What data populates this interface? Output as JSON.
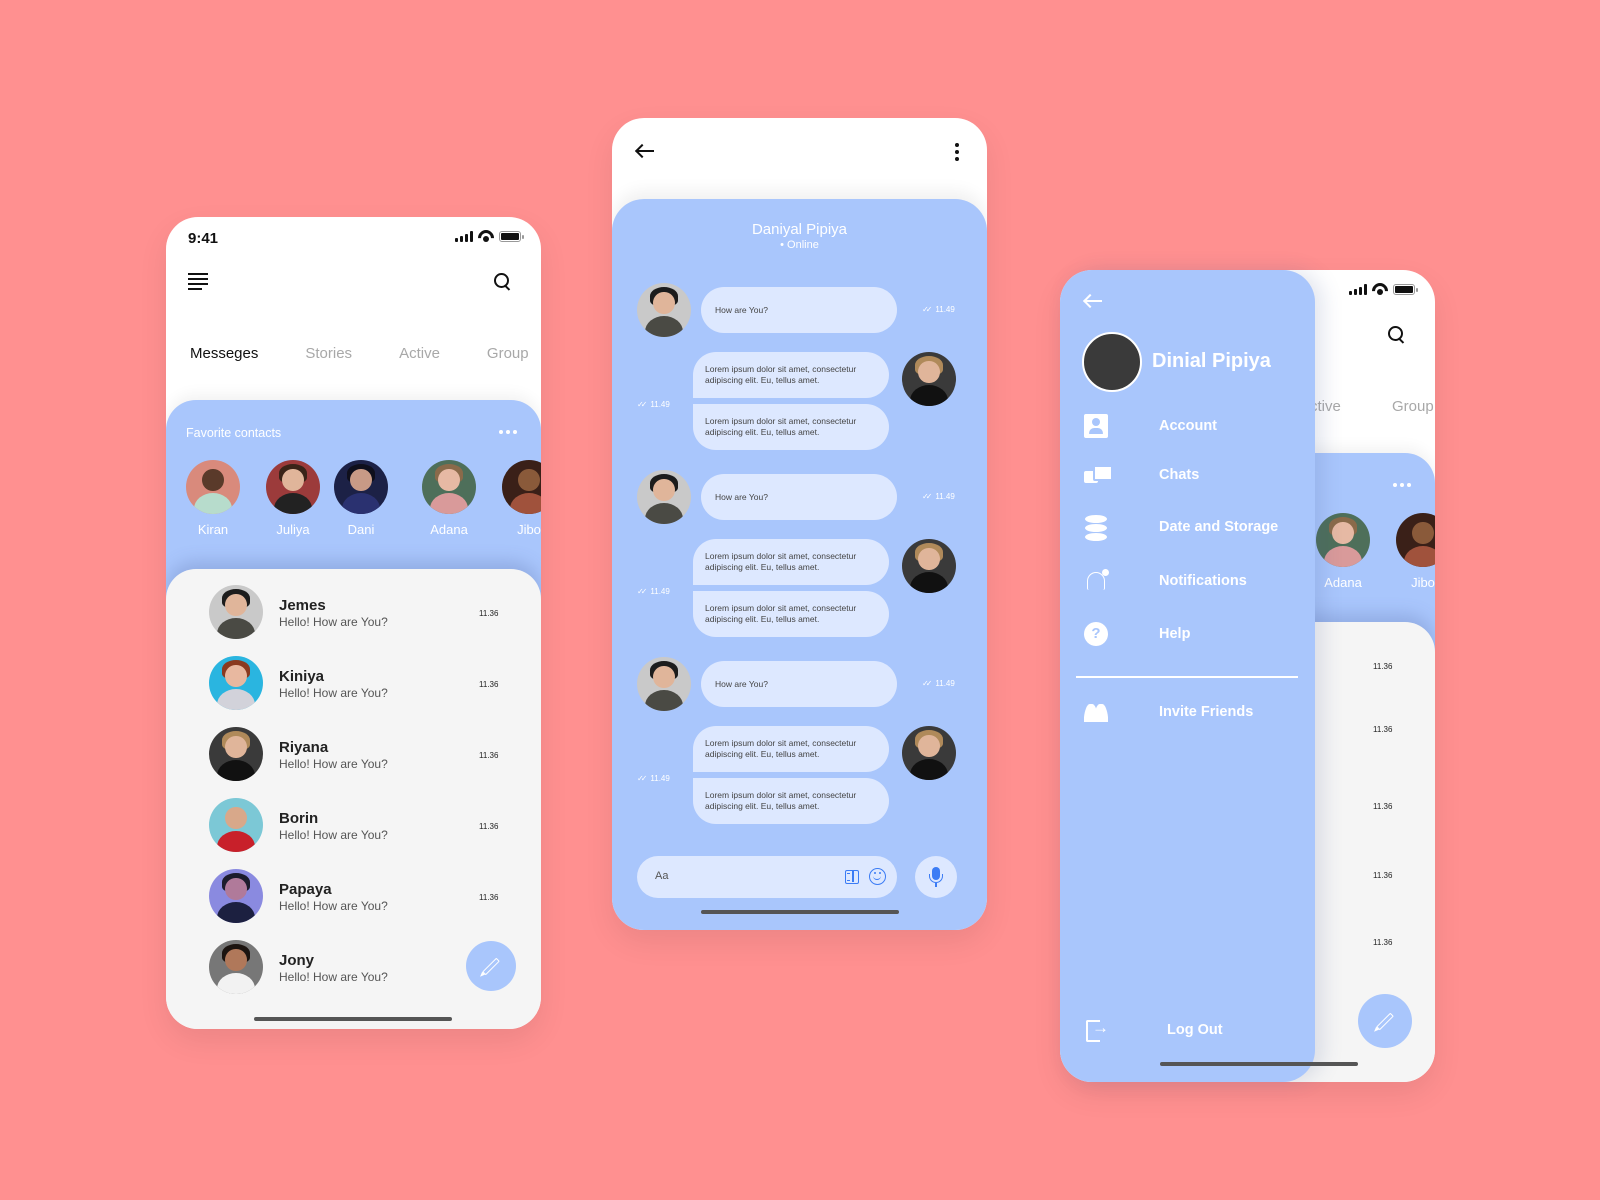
{
  "colors": {
    "background": "#ff9090",
    "accent": "#a9c6fc",
    "bubble": "#dde8ff",
    "icon_blue": "#3b7cf5",
    "list_bg": "#f5f5f5"
  },
  "home": {
    "status": {
      "time": "9:41"
    },
    "icons": {
      "menu": "menu-icon",
      "search": "search-icon"
    },
    "tabs": [
      "Messeges",
      "Stories",
      "Active",
      "Group"
    ],
    "favorites": {
      "title": "Favorite contacts",
      "contacts": [
        "Kiran",
        "Juliya",
        "Dani",
        "Adana",
        "Jibo"
      ]
    },
    "chats": [
      {
        "name": "Jemes",
        "message": "Hello! How are You?",
        "time": "11.36"
      },
      {
        "name": "Kiniya",
        "message": "Hello! How are You?",
        "time": "11.36"
      },
      {
        "name": "Riyana",
        "message": "Hello! How are You?",
        "time": "11.36"
      },
      {
        "name": "Borin",
        "message": "Hello! How are You?",
        "time": "11.36"
      },
      {
        "name": "Papaya",
        "message": "Hello! How are You?",
        "time": "11.36"
      },
      {
        "name": "Jony",
        "message": "Hello! How are You?",
        "time": ""
      }
    ],
    "fab_icon": "pencil-icon"
  },
  "conversation": {
    "contact_name": "Daniyal Pipiya",
    "contact_status": "• Online",
    "messages": [
      {
        "direction": "in",
        "text": "How are You?",
        "time": "11.49"
      },
      {
        "direction": "out",
        "texts": [
          "Lorem ipsum dolor sit amet, consectetur adipiscing elit. Eu, tellus amet.",
          "Lorem ipsum dolor sit amet, consectetur adipiscing elit. Eu, tellus amet."
        ],
        "time": "11.49"
      },
      {
        "direction": "in",
        "text": "How are You?",
        "time": "11.49"
      },
      {
        "direction": "out",
        "texts": [
          "Lorem ipsum dolor sit amet, consectetur adipiscing elit. Eu, tellus amet.",
          "Lorem ipsum dolor sit amet, consectetur adipiscing elit. Eu, tellus amet."
        ],
        "time": "11.49"
      },
      {
        "direction": "in",
        "text": "How are You?",
        "time": "11.49"
      },
      {
        "direction": "out",
        "texts": [
          "Lorem ipsum dolor sit amet, consectetur adipiscing elit. Eu, tellus amet.",
          "Lorem ipsum dolor sit amet, consectetur adipiscing elit. Eu, tellus amet."
        ],
        "time": "11.49"
      }
    ],
    "composer": {
      "placeholder": "Aa"
    }
  },
  "drawer": {
    "profile_name": "Dinial Pipiya",
    "menu": [
      {
        "label": "Account",
        "icon": "account-icon"
      },
      {
        "label": "Chats",
        "icon": "chats-icon"
      },
      {
        "label": "Date and Storage",
        "icon": "database-icon"
      },
      {
        "label": "Notifications",
        "icon": "bell-icon"
      },
      {
        "label": "Help",
        "icon": "help-icon"
      }
    ],
    "secondary": [
      {
        "label": "Invite Friends",
        "icon": "friends-icon"
      }
    ],
    "logout": {
      "label": "Log Out",
      "icon": "logout-icon"
    },
    "background_tabs": [
      "ctive",
      "Group"
    ],
    "background_favorites": [
      "Adana",
      "Jibo"
    ],
    "background_times": [
      "11.36",
      "11.36",
      "11.36",
      "11.36",
      "11.36"
    ]
  }
}
